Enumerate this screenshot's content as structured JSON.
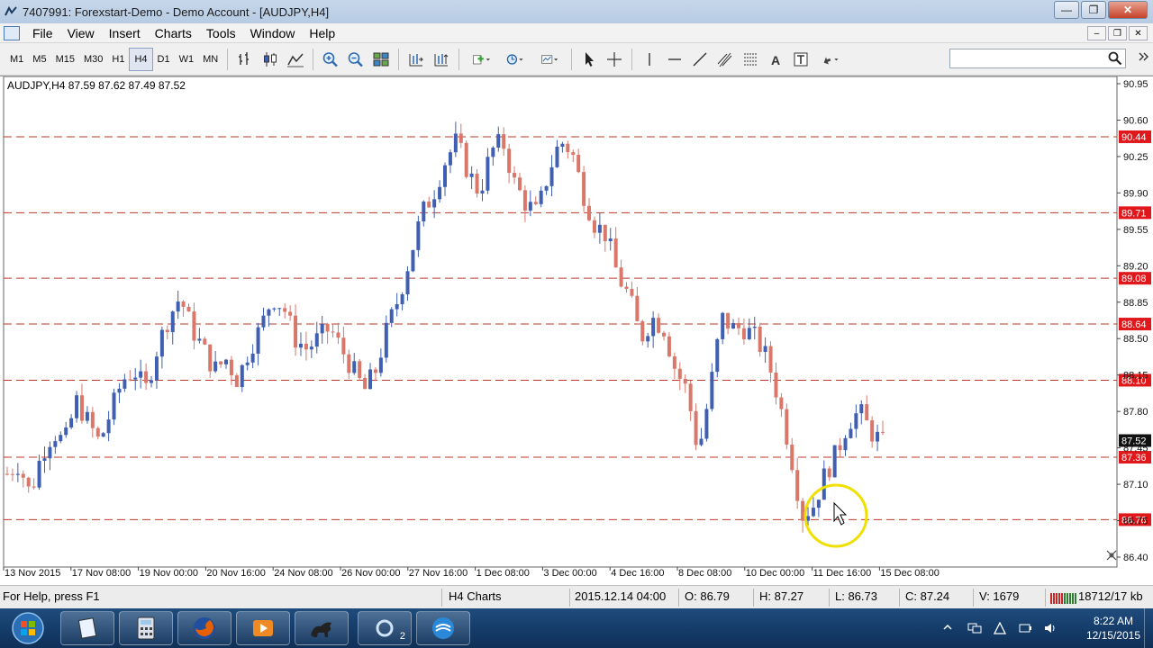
{
  "window": {
    "title": "7407991: Forexstart-Demo - Demo Account - [AUDJPY,H4]"
  },
  "menu": [
    "File",
    "View",
    "Insert",
    "Charts",
    "Tools",
    "Window",
    "Help"
  ],
  "timeframes": [
    "M1",
    "M5",
    "M15",
    "M30",
    "H1",
    "H4",
    "D1",
    "W1",
    "MN"
  ],
  "active_timeframe": "H4",
  "chart": {
    "symbol_label": "AUDJPY,H4  87.59 87.62 87.49 87.52",
    "price_axis": [
      "90.95",
      "90.60",
      "90.25",
      "89.90",
      "89.55",
      "89.20",
      "88.85",
      "88.50",
      "88.15",
      "87.80",
      "87.45",
      "87.10",
      "86.75",
      "86.40"
    ],
    "levels": [
      "90.44",
      "89.71",
      "89.08",
      "88.64",
      "88.10",
      "87.36",
      "86.76"
    ],
    "current_price": "87.52",
    "time_axis": [
      "13 Nov 2015",
      "17 Nov 08:00",
      "19 Nov 00:00",
      "20 Nov 16:00",
      "24 Nov 08:00",
      "26 Nov 00:00",
      "27 Nov 16:00",
      "1 Dec 08:00",
      "3 Dec 00:00",
      "4 Dec 16:00",
      "8 Dec 08:00",
      "10 Dec 00:00",
      "11 Dec 16:00",
      "15 Dec 08:00"
    ],
    "colors": {
      "bull": "#3f5fb3",
      "bear": "#d9776a",
      "level": "#b93a2e",
      "label_bg": "#e0181b",
      "grid_bg": "#ffffff"
    }
  },
  "chart_data": {
    "type": "candlestick",
    "symbol": "AUDJPY",
    "timeframe": "H4",
    "ylim": [
      86.4,
      90.95
    ],
    "x_tick_labels": [
      "13 Nov 2015",
      "17 Nov 08:00",
      "19 Nov 00:00",
      "20 Nov 16:00",
      "24 Nov 08:00",
      "26 Nov 00:00",
      "27 Nov 16:00",
      "1 Dec 08:00",
      "3 Dec 00:00",
      "4 Dec 16:00",
      "8 Dec 08:00",
      "10 Dec 00:00",
      "11 Dec 16:00",
      "15 Dec 08:00"
    ],
    "horizontal_levels": [
      90.44,
      89.71,
      89.08,
      88.64,
      88.1,
      87.36,
      86.76
    ],
    "last_bar": {
      "open": 87.59,
      "high": 87.62,
      "low": 87.49,
      "close": 87.52
    },
    "close_path": [
      87.2,
      87.3,
      87.0,
      87.4,
      87.6,
      87.5,
      87.9,
      87.7,
      87.5,
      87.8,
      88.1,
      88.2,
      88.0,
      88.4,
      88.7,
      88.9,
      88.6,
      88.4,
      88.2,
      88.3,
      88.1,
      88.4,
      88.6,
      88.9,
      88.8,
      88.5,
      88.4,
      88.5,
      88.6,
      88.4,
      88.2,
      88.0,
      88.2,
      88.6,
      88.9,
      89.3,
      89.7,
      89.9,
      90.2,
      90.4,
      90.1,
      89.9,
      90.3,
      90.4,
      90.0,
      89.8,
      89.7,
      90.1,
      90.4,
      90.3,
      89.9,
      89.6,
      89.5,
      89.1,
      88.9,
      88.5,
      88.7,
      88.6,
      88.2,
      88.0,
      87.4,
      88.0,
      88.7,
      88.6,
      88.6,
      88.5,
      88.3,
      87.9,
      87.4,
      86.8,
      86.9,
      87.2,
      87.4,
      87.7,
      87.8,
      87.6,
      87.5
    ],
    "annotation": "highlight circle around 11 Dec lows"
  },
  "status": {
    "help": "For Help, press F1",
    "profile": "H4 Charts",
    "datetime": "2015.12.14 04:00",
    "open": "O: 86.79",
    "high": "H: 87.27",
    "low": "L: 86.73",
    "close": "C: 87.24",
    "volume": "V: 1679",
    "traffic": "18712/17 kb"
  },
  "taskbar": {
    "badge": "2",
    "clock_time": "8:22 AM",
    "clock_date": "12/15/2015"
  }
}
